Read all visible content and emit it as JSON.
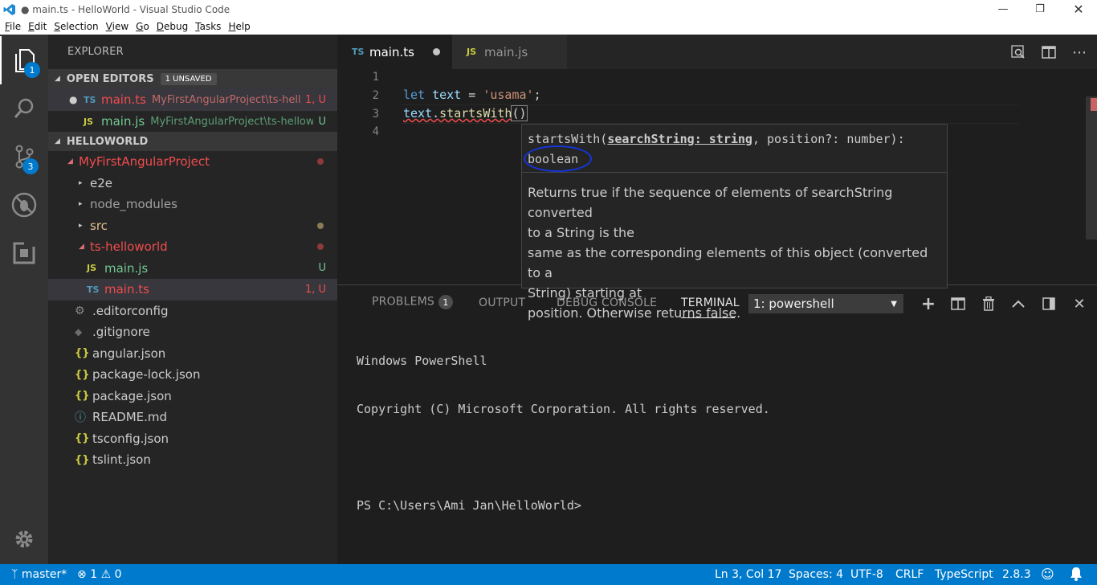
{
  "window": {
    "title": "● main.ts - HelloWorld - Visual Studio Code",
    "controls": [
      "minimize-icon",
      "restore-icon",
      "close-icon"
    ]
  },
  "menu": [
    "File",
    "Edit",
    "Selection",
    "View",
    "Go",
    "Debug",
    "Tasks",
    "Help"
  ],
  "activity": {
    "explorer_badge": "1",
    "scm_badge": "3"
  },
  "sidebar": {
    "title": "EXPLORER",
    "open_editors": {
      "header": "OPEN EDITORS",
      "badge": "1 UNSAVED",
      "items": [
        {
          "type": "TS",
          "name": "main.ts",
          "path": "MyFirstAngularProject\\ts-hell...",
          "status": "1, U"
        },
        {
          "type": "JS",
          "name": "main.js",
          "path": "MyFirstAngularProject\\ts-hellow...",
          "status": "U"
        }
      ]
    },
    "workspace": {
      "header": "HELLOWORLD",
      "project": "MyFirstAngularProject",
      "folders": [
        "e2e",
        "node_modules",
        "src",
        "ts-helloworld"
      ],
      "ts_files": [
        {
          "type": "JS",
          "name": "main.js",
          "status": "U"
        },
        {
          "type": "TS",
          "name": "main.ts",
          "status": "1, U"
        }
      ],
      "files": [
        ".editorconfig",
        ".gitignore",
        "angular.json",
        "package-lock.json",
        "package.json",
        "README.md",
        "tsconfig.json",
        "tslint.json"
      ]
    }
  },
  "tabs": [
    {
      "type": "TS",
      "label": "main.ts"
    },
    {
      "type": "JS",
      "label": "main.js"
    }
  ],
  "editor": {
    "line_numbers": [
      "1",
      "2",
      "3",
      "4"
    ],
    "line2": {
      "kw": "let",
      "var": "text",
      "eq": " = ",
      "str": "'usama'",
      "semi": ";"
    },
    "line3": {
      "obj": "text",
      "dot": ".",
      "fn": "startsWith",
      "paren": "()"
    }
  },
  "hover": {
    "sig_prefix": "startsWith(",
    "sig_param": "searchString: string",
    "sig_rest": ", position?: number):",
    "return_type": "boolean",
    "doc_lines": [
      "Returns true if the sequence of elements of searchString converted",
      "to a String is the",
      "same as the corresponding elements of this object (converted to a",
      "String) starting at",
      "position. Otherwise returns false."
    ]
  },
  "panel": {
    "tabs": {
      "problems": "PROBLEMS",
      "problems_count": "1",
      "output": "OUTPUT",
      "debug": "DEBUG CONSOLE",
      "terminal": "TERMINAL"
    },
    "terminal_select": "1: powershell",
    "terminal_lines": [
      "Windows PowerShell",
      "Copyright (C) Microsoft Corporation. All rights reserved.",
      "",
      "PS C:\\Users\\Ami Jan\\HelloWorld>"
    ]
  },
  "status": {
    "branch": "master*",
    "errors": "1",
    "warnings": "0",
    "position": "Ln 3, Col 17",
    "spaces": "Spaces: 4",
    "encoding": "UTF-8",
    "eol": "CRLF",
    "language": "TypeScript",
    "version": "2.8.3"
  }
}
